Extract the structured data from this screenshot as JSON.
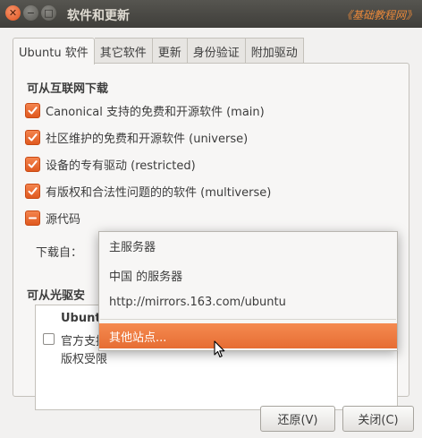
{
  "window": {
    "title": "软件和更新",
    "watermark": "《基础教程网》"
  },
  "tabs": [
    {
      "label": "Ubuntu 软件",
      "active": true
    },
    {
      "label": "其它软件",
      "active": false
    },
    {
      "label": "更新",
      "active": false
    },
    {
      "label": "身份验证",
      "active": false
    },
    {
      "label": "附加驱动",
      "active": false
    }
  ],
  "internet": {
    "title": "可从互联网下载",
    "items": [
      {
        "label": "Canonical 支持的免费和开源软件 (main)",
        "state": "checked"
      },
      {
        "label": "社区维护的免费和开源软件 (universe)",
        "state": "checked"
      },
      {
        "label": "设备的专有驱动 (restricted)",
        "state": "checked"
      },
      {
        "label": "有版权和合法性问题的的软件 (multiverse)",
        "state": "checked"
      },
      {
        "label": "源代码",
        "state": "mixed"
      }
    ],
    "download_from_label": "下载自："
  },
  "cdrom": {
    "title": "可从光驱安",
    "row1": "Ubuntu",
    "row2": "官方支持",
    "row3": "版权受限"
  },
  "dropdown": {
    "options": [
      "主服务器",
      "中国 的服务器",
      "http://mirrors.163.com/ubuntu",
      "其他站点..."
    ],
    "highlighted": "其他站点..."
  },
  "buttons": {
    "revert": "还原(V)",
    "close": "关闭(C)"
  },
  "colors": {
    "accent": "#e66d33",
    "titlebar": "#4a4945",
    "background": "#f2f1f0"
  }
}
